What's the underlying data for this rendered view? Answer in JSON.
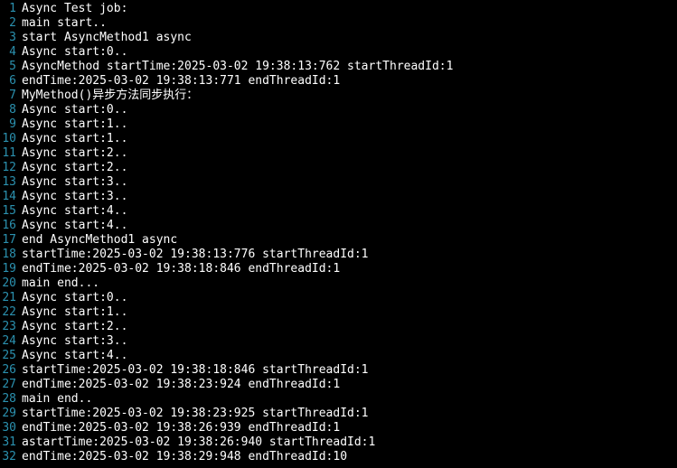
{
  "lines": [
    {
      "num": "1",
      "text": "Async Test job:"
    },
    {
      "num": "2",
      "text": "main start.."
    },
    {
      "num": "3",
      "text": "start AsyncMethod1 async"
    },
    {
      "num": "4",
      "text": "Async start:0.."
    },
    {
      "num": "5",
      "text": "AsyncMethod startTime:2025-03-02 19:38:13:762 startThreadId:1"
    },
    {
      "num": "6",
      "text": "endTime:2025-03-02 19:38:13:771 endThreadId:1"
    },
    {
      "num": "7",
      "text": "MyMethod()异步方法同步执行："
    },
    {
      "num": "8",
      "text": "Async start:0.."
    },
    {
      "num": "9",
      "text": "Async start:1.."
    },
    {
      "num": "10",
      "text": "Async start:1.."
    },
    {
      "num": "11",
      "text": "Async start:2.."
    },
    {
      "num": "12",
      "text": "Async start:2.."
    },
    {
      "num": "13",
      "text": "Async start:3.."
    },
    {
      "num": "14",
      "text": "Async start:3.."
    },
    {
      "num": "15",
      "text": "Async start:4.."
    },
    {
      "num": "16",
      "text": "Async start:4.."
    },
    {
      "num": "17",
      "text": "end AsyncMethod1 async"
    },
    {
      "num": "18",
      "text": "startTime:2025-03-02 19:38:13:776 startThreadId:1"
    },
    {
      "num": "19",
      "text": "endTime:2025-03-02 19:38:18:846 endThreadId:1"
    },
    {
      "num": "20",
      "text": "main end..."
    },
    {
      "num": "21",
      "text": "Async start:0.."
    },
    {
      "num": "22",
      "text": "Async start:1.."
    },
    {
      "num": "23",
      "text": "Async start:2.."
    },
    {
      "num": "24",
      "text": "Async start:3.."
    },
    {
      "num": "25",
      "text": "Async start:4.."
    },
    {
      "num": "26",
      "text": "startTime:2025-03-02 19:38:18:846 startThreadId:1"
    },
    {
      "num": "27",
      "text": "endTime:2025-03-02 19:38:23:924 endThreadId:1"
    },
    {
      "num": "28",
      "text": "main end.."
    },
    {
      "num": "29",
      "text": "startTime:2025-03-02 19:38:23:925 startThreadId:1"
    },
    {
      "num": "30",
      "text": "endTime:2025-03-02 19:38:26:939 endThreadId:1"
    },
    {
      "num": "31",
      "text": "astartTime:2025-03-02 19:38:26:940 startThreadId:1"
    },
    {
      "num": "32",
      "text": "endTime:2025-03-02 19:38:29:948 endThreadId:10"
    }
  ]
}
